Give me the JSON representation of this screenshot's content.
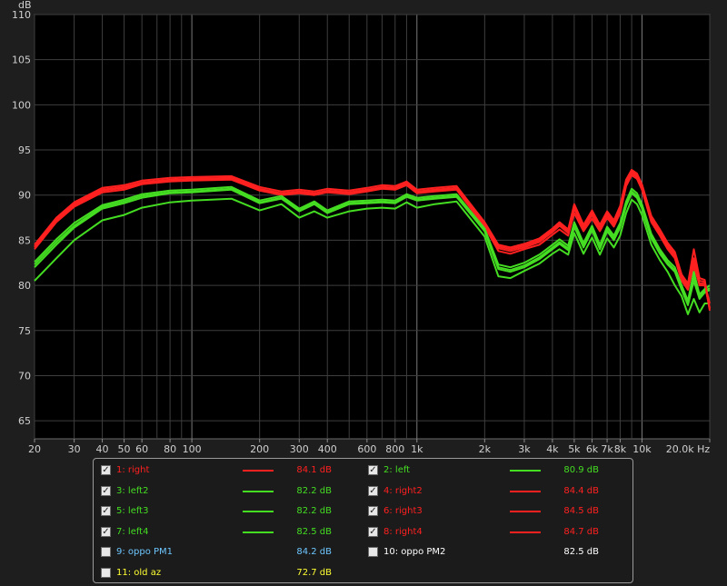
{
  "chart_data": {
    "type": "line",
    "xscale": "log",
    "ylabel": "dB",
    "xunit": "Hz",
    "xlim": [
      20,
      20000
    ],
    "ylim": [
      63,
      110
    ],
    "grid": true,
    "yticks": [
      65,
      70,
      75,
      80,
      85,
      90,
      95,
      100,
      105,
      110
    ],
    "xticks": [
      {
        "v": 20,
        "label": "20"
      },
      {
        "v": 30,
        "label": "30"
      },
      {
        "v": 40,
        "label": "40"
      },
      {
        "v": 50,
        "label": "50"
      },
      {
        "v": 60,
        "label": "60"
      },
      {
        "v": 80,
        "label": "80"
      },
      {
        "v": 100,
        "label": "100"
      },
      {
        "v": 200,
        "label": "200"
      },
      {
        "v": 300,
        "label": "300"
      },
      {
        "v": 400,
        "label": "400"
      },
      {
        "v": 600,
        "label": "600"
      },
      {
        "v": 800,
        "label": "800"
      },
      {
        "v": 1000,
        "label": "1k"
      },
      {
        "v": 2000,
        "label": "2k"
      },
      {
        "v": 3000,
        "label": "3k"
      },
      {
        "v": 4000,
        "label": "4k"
      },
      {
        "v": 5000,
        "label": "5k"
      },
      {
        "v": 6000,
        "label": "6k"
      },
      {
        "v": 7000,
        "label": "7k"
      },
      {
        "v": 8000,
        "label": "8k"
      },
      {
        "v": 10000,
        "label": "10k"
      },
      {
        "v": 20000,
        "label": "20.0k Hz"
      }
    ],
    "x": [
      20,
      25,
      30,
      40,
      50,
      60,
      80,
      100,
      150,
      200,
      250,
      300,
      350,
      400,
      500,
      600,
      700,
      800,
      900,
      1000,
      1200,
      1500,
      2000,
      2300,
      2600,
      3000,
      3500,
      4000,
      4300,
      4700,
      5000,
      5500,
      6000,
      6500,
      7000,
      7500,
      8000,
      8500,
      9000,
      9500,
      10000,
      11000,
      12000,
      13000,
      14000,
      15000,
      16000,
      17000,
      18000,
      19000,
      20000
    ],
    "series": [
      {
        "name": "1: right",
        "color": "#ff2020",
        "checked": true,
        "value": "84.1 dB",
        "values": [
          84.0,
          87.0,
          88.7,
          90.3,
          90.6,
          91.2,
          91.5,
          91.6,
          91.7,
          90.5,
          90.0,
          90.2,
          90.0,
          90.3,
          90.1,
          90.4,
          90.7,
          90.6,
          91.1,
          90.2,
          90.4,
          90.6,
          86.5,
          83.8,
          83.5,
          84.0,
          84.5,
          85.6,
          86.2,
          85.5,
          88.0,
          86.0,
          87.4,
          86.0,
          87.5,
          86.5,
          88.0,
          91.0,
          92.2,
          91.8,
          90.6,
          87.0,
          85.5,
          84.0,
          83.0,
          80.5,
          79.5,
          82.5,
          80.0,
          80.0,
          77.5
        ]
      },
      {
        "name": "2: left",
        "color": "#44dd22",
        "checked": true,
        "value": "80.9 dB",
        "values": [
          80.5,
          83.0,
          85.0,
          87.2,
          87.8,
          88.6,
          89.2,
          89.4,
          89.6,
          88.3,
          89.0,
          87.5,
          88.2,
          87.5,
          88.2,
          88.5,
          88.6,
          88.5,
          89.2,
          88.6,
          89.0,
          89.3,
          85.4,
          81.0,
          80.8,
          81.6,
          82.4,
          83.5,
          84.0,
          83.4,
          85.8,
          83.5,
          85.3,
          83.4,
          85.2,
          84.2,
          85.5,
          88.0,
          89.5,
          89.0,
          87.8,
          84.5,
          82.8,
          81.5,
          80.0,
          78.8,
          76.8,
          78.5,
          77.0,
          78.0,
          78.0
        ]
      },
      {
        "name": "3: left2",
        "color": "#44dd22",
        "checked": true,
        "value": "82.2 dB",
        "values": [
          82.0,
          84.5,
          86.4,
          88.5,
          89.1,
          89.7,
          90.2,
          90.3,
          90.6,
          89.1,
          89.6,
          88.2,
          89.0,
          88.0,
          89.0,
          89.1,
          89.2,
          89.1,
          89.8,
          89.4,
          89.6,
          89.8,
          86.0,
          81.8,
          81.5,
          82.0,
          82.9,
          84.0,
          84.6,
          83.9,
          86.5,
          84.2,
          86.1,
          84.0,
          86.0,
          85.0,
          86.4,
          88.8,
          90.2,
          89.7,
          88.5,
          85.2,
          83.5,
          82.3,
          81.5,
          79.5,
          77.8,
          80.5,
          78.5,
          79.2,
          79.5
        ]
      },
      {
        "name": "4: right2",
        "color": "#ff2020",
        "checked": true,
        "value": "84.4 dB",
        "values": [
          84.2,
          87.2,
          88.9,
          90.5,
          90.8,
          91.3,
          91.6,
          91.7,
          91.8,
          90.6,
          90.1,
          90.3,
          90.1,
          90.4,
          90.2,
          90.5,
          90.8,
          90.7,
          91.2,
          90.3,
          90.5,
          90.7,
          86.7,
          84.1,
          83.8,
          84.2,
          84.8,
          85.9,
          86.6,
          85.8,
          88.5,
          86.3,
          87.8,
          86.3,
          87.8,
          86.8,
          88.4,
          91.3,
          92.4,
          92.0,
          90.8,
          87.3,
          85.8,
          84.3,
          83.3,
          80.8,
          79.8,
          82.0,
          80.2,
          80.2,
          78.0
        ]
      },
      {
        "name": "5: left3",
        "color": "#44dd22",
        "checked": true,
        "value": "82.2 dB",
        "values": [
          82.3,
          84.8,
          86.6,
          88.7,
          89.3,
          89.9,
          90.3,
          90.4,
          90.7,
          89.2,
          89.7,
          88.3,
          89.1,
          88.1,
          89.1,
          89.2,
          89.3,
          89.2,
          89.9,
          89.5,
          89.7,
          89.9,
          86.1,
          82.0,
          81.7,
          82.2,
          83.1,
          84.2,
          84.8,
          84.1,
          86.7,
          84.4,
          86.3,
          84.2,
          86.2,
          85.2,
          86.6,
          89.0,
          90.4,
          89.9,
          88.7,
          85.4,
          83.7,
          82.5,
          81.7,
          79.7,
          78.0,
          81.0,
          78.7,
          79.4,
          79.7
        ]
      },
      {
        "name": "6: right3",
        "color": "#ff2020",
        "checked": true,
        "value": "84.5 dB",
        "values": [
          84.3,
          87.3,
          89.0,
          90.6,
          90.9,
          91.4,
          91.7,
          91.8,
          91.9,
          90.7,
          90.2,
          90.4,
          90.2,
          90.5,
          90.3,
          90.6,
          90.9,
          90.8,
          91.3,
          90.4,
          90.6,
          90.8,
          86.8,
          84.3,
          84.0,
          84.4,
          85.0,
          86.1,
          86.8,
          86.0,
          88.8,
          86.5,
          88.1,
          86.5,
          88.0,
          87.0,
          88.6,
          91.5,
          92.6,
          92.2,
          91.0,
          87.5,
          86.0,
          84.5,
          83.5,
          81.0,
          80.0,
          83.0,
          80.5,
          80.4,
          77.2
        ]
      },
      {
        "name": "7: left4",
        "color": "#44dd22",
        "checked": true,
        "value": "82.5 dB",
        "values": [
          82.6,
          85.1,
          86.9,
          88.9,
          89.5,
          90.1,
          90.5,
          90.6,
          90.9,
          89.4,
          89.9,
          88.5,
          89.3,
          88.3,
          89.3,
          89.4,
          89.5,
          89.4,
          90.1,
          89.7,
          89.9,
          90.1,
          86.3,
          82.3,
          82.0,
          82.5,
          83.4,
          84.5,
          85.1,
          84.4,
          87.0,
          84.7,
          86.6,
          84.5,
          86.5,
          85.5,
          86.9,
          89.3,
          90.7,
          90.2,
          89.0,
          85.7,
          84.0,
          82.8,
          82.0,
          80.0,
          78.3,
          81.5,
          79.0,
          79.6,
          80.0
        ]
      },
      {
        "name": "8: right4",
        "color": "#ff2020",
        "checked": true,
        "value": "84.7 dB",
        "values": [
          84.5,
          87.5,
          89.2,
          90.8,
          91.1,
          91.6,
          91.9,
          92.0,
          92.1,
          90.9,
          90.4,
          90.6,
          90.4,
          90.7,
          90.5,
          90.8,
          91.1,
          91.0,
          91.5,
          90.6,
          90.8,
          91.0,
          87.0,
          84.5,
          84.2,
          84.6,
          85.2,
          86.3,
          87.0,
          86.2,
          89.0,
          86.7,
          88.3,
          86.7,
          88.2,
          87.2,
          88.8,
          91.7,
          92.8,
          92.4,
          91.2,
          87.7,
          86.2,
          84.7,
          83.7,
          81.2,
          80.2,
          84.0,
          80.8,
          80.6,
          77.4
        ]
      },
      {
        "name": "9: oppo PM1",
        "color": "#6ec6ff",
        "checked": false,
        "value": "84.2 dB"
      },
      {
        "name": "10: oppo PM2",
        "color": "#ffffff",
        "checked": false,
        "value": "82.5 dB"
      },
      {
        "name": "11: old az",
        "color": "#ffff33",
        "checked": false,
        "value": "72.7 dB"
      }
    ]
  }
}
